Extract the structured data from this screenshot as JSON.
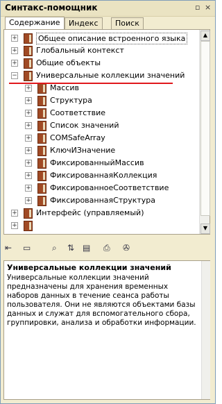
{
  "window": {
    "title": "Синтакс-помощник",
    "pin_glyph": "▫",
    "close_glyph": "×"
  },
  "tabs": [
    {
      "label": "Содержание",
      "active": true
    },
    {
      "label": "Индекс",
      "active": false
    },
    {
      "label": "Поиск",
      "active": false
    }
  ],
  "tree": [
    {
      "label": "Общее описание встроенного языка",
      "level": 0,
      "expanded": false,
      "selected": true
    },
    {
      "label": "Глобальный контекст",
      "level": 0,
      "expanded": false
    },
    {
      "label": "Общие объекты",
      "level": 0,
      "expanded": false
    },
    {
      "label": "Универсальные коллекции значений",
      "level": 0,
      "expanded": true
    },
    {
      "label": "Массив",
      "level": 1,
      "expanded": false
    },
    {
      "label": "Структура",
      "level": 1,
      "expanded": false
    },
    {
      "label": "Соответствие",
      "level": 1,
      "expanded": false
    },
    {
      "label": "Список значений",
      "level": 1,
      "expanded": false
    },
    {
      "label": "COMSafeArray",
      "level": 1,
      "expanded": false
    },
    {
      "label": "КлючИЗначение",
      "level": 1,
      "expanded": false
    },
    {
      "label": "ФиксированныйМассив",
      "level": 1,
      "expanded": false
    },
    {
      "label": "ФиксированнаяКоллекция",
      "level": 1,
      "expanded": false
    },
    {
      "label": "ФиксированноеСоответствие",
      "level": 1,
      "expanded": false
    },
    {
      "label": "ФиксированнаяСтруктура",
      "level": 1,
      "expanded": false
    },
    {
      "label": "Интерфейс (управляемый)",
      "level": 0,
      "expanded": false
    },
    {
      "label": "",
      "level": 0,
      "expanded": false
    }
  ],
  "toolbar": [
    {
      "name": "back-button",
      "glyph": "⇤"
    },
    {
      "name": "forward-button",
      "glyph": "▭"
    },
    {
      "name": "find-in-tree-button",
      "glyph": "⌕"
    },
    {
      "name": "sync-button",
      "glyph": "⇅"
    },
    {
      "name": "collapse-button",
      "glyph": "▤"
    },
    {
      "name": "print-button",
      "glyph": "⎙"
    },
    {
      "name": "settings-button",
      "glyph": "✇"
    }
  ],
  "description": {
    "title": "Универсальные коллекции значений",
    "text": "Универсальные коллекции значений предназначены для хранения временных наборов данных в течение сеанса работы пользователя. Они не являются объектами базы данных и служат для вспомогательного сбора, группировки, анализа и обработки информации."
  }
}
